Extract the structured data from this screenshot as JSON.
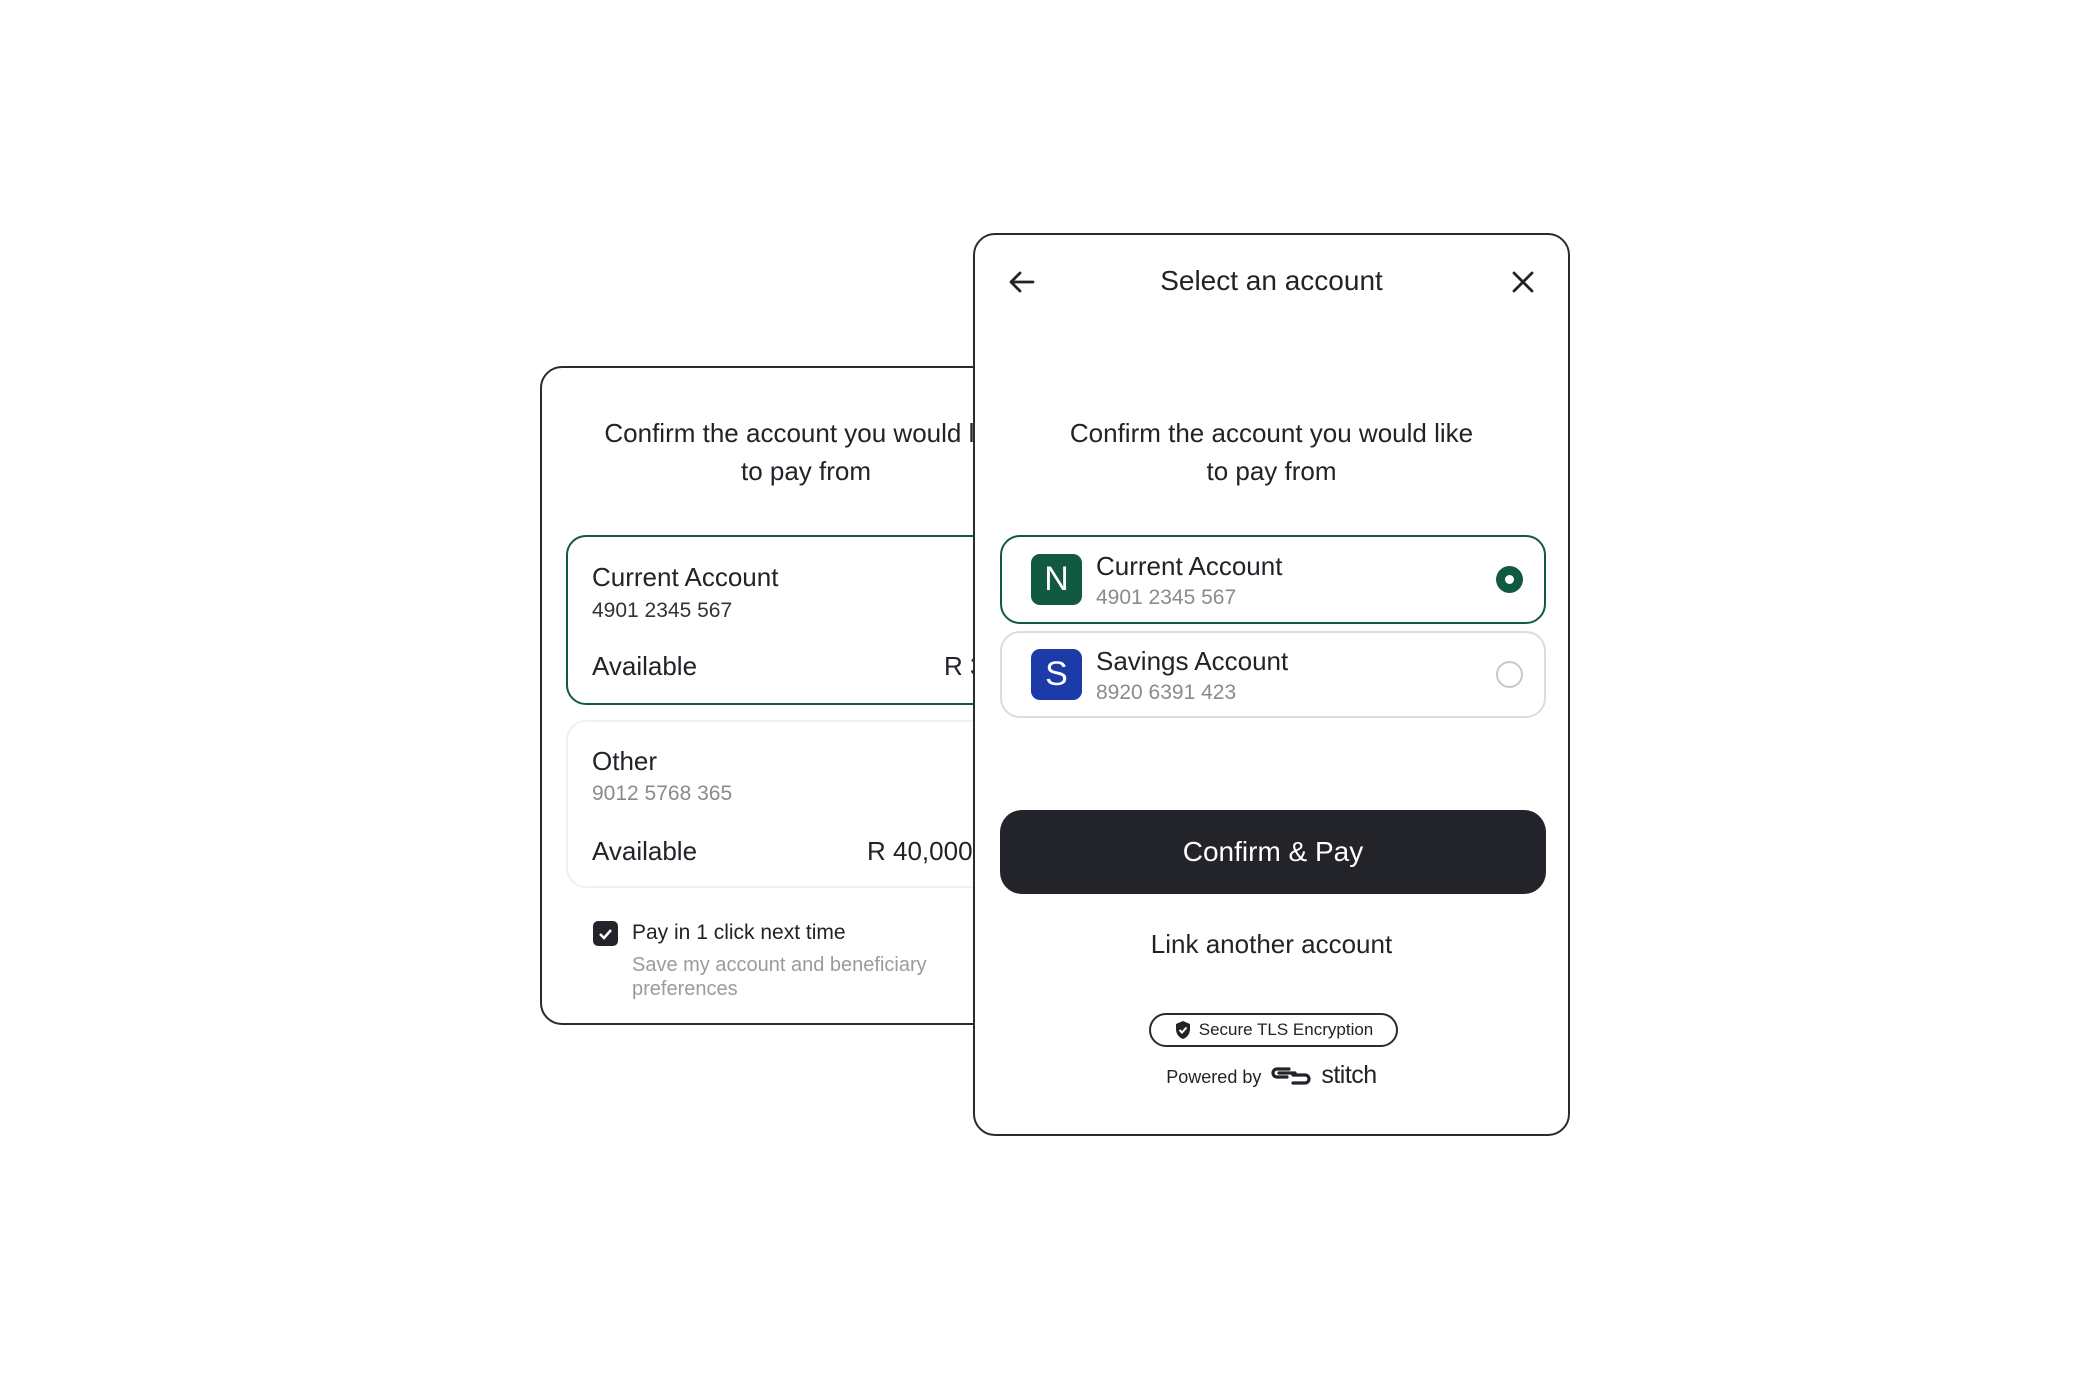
{
  "back_card": {
    "subtitle_line1": "Confirm the account you would like",
    "subtitle_line2": "to pay from",
    "accounts": [
      {
        "name": "Current Account",
        "number": "4901 2345 567",
        "available_label": "Available",
        "available_value": "R 3"
      },
      {
        "name": "Other",
        "number": "9012 5768 365",
        "available_label": "Available",
        "available_value": "R 40,000"
      }
    ],
    "checkbox": {
      "label": "Pay in 1 click next time",
      "checked": true,
      "description_line1": "Save my account and beneficiary",
      "description_line2": "preferences"
    }
  },
  "front_card": {
    "title": "Select an account",
    "back_icon": "arrow-left-icon",
    "close_icon": "close-icon",
    "subtitle_line1": "Confirm the account you would like",
    "subtitle_line2": "to pay from",
    "accounts": [
      {
        "initial": "N",
        "name": "Current Account",
        "number": "4901 2345 567",
        "selected": true,
        "color": "#115a3f"
      },
      {
        "initial": "S",
        "name": "Savings Account",
        "number": "8920 6391 423",
        "selected": false,
        "color": "#1d3ba8"
      }
    ],
    "confirm_button": "Confirm & Pay",
    "link_account": "Link another account",
    "security_badge": "Secure TLS Encryption",
    "powered_by": "Powered by",
    "brand": "stitch"
  },
  "colors": {
    "accent": "#115a3f",
    "button": "#23232a"
  }
}
